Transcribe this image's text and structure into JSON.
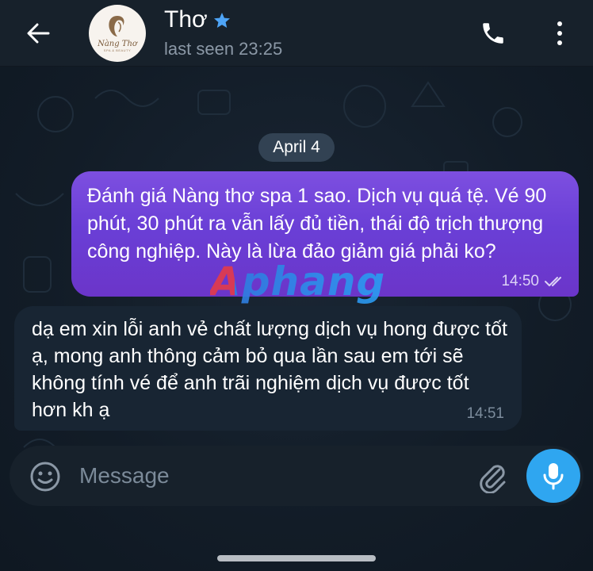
{
  "header": {
    "contact_name": "Thơ",
    "status": "last seen 23:25",
    "avatar_logo_text": "Nàng Thơ",
    "avatar_logo_sub": "SPA & BEAUTY"
  },
  "chat": {
    "date_label": "April 4",
    "messages": [
      {
        "direction": "outgoing",
        "text": "Đánh giá Nàng thơ spa 1 sao. Dịch vụ quá tệ. Vé 90 phút, 30 phút ra vẫn lấy đủ tiền, thái độ trịch thượng công nghiệp. Này là lừa đảo giảm giá phải ko?",
        "time": "14:50",
        "status_icon": "double-check-icon"
      },
      {
        "direction": "incoming",
        "text": "dạ em xin lỗi anh vẻ chất lượng dịch vụ hong được tốt ạ, mong anh thông cảm bỏ qua lần sau em tới sẽ không tính vé để anh trãi nghiệm dịch vụ được tốt hơn kh ạ",
        "time": "14:51"
      }
    ]
  },
  "watermark": "Aphang",
  "composer": {
    "placeholder": "Message",
    "value": ""
  },
  "icons": {
    "back": "arrow-left-icon",
    "verified": "star-icon",
    "call": "phone-icon",
    "menu": "more-vertical-icon",
    "emoji": "smile-icon",
    "attach": "paperclip-icon",
    "mic": "mic-icon"
  },
  "colors": {
    "header_bg": "#17212b",
    "outgoing_bubble": "#7d4fe0",
    "incoming_bubble": "#182533",
    "accent": "#2fa6f0",
    "star": "#4ea4f6"
  }
}
